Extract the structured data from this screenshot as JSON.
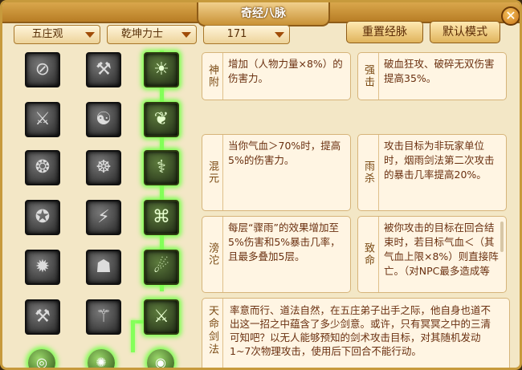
{
  "window": {
    "title": "奇经八脉",
    "close_glyph": "✕"
  },
  "filters": {
    "sect": "五庄观",
    "school": "乾坤力士",
    "level": "171"
  },
  "buttons": {
    "reset": "重置经脉",
    "default": "默认模式"
  },
  "skills": {
    "rows": [
      [
        "⊘",
        "⚒",
        "☀"
      ],
      [
        "⚔",
        "☯",
        "❦"
      ],
      [
        "❂",
        "☸",
        "⚕"
      ],
      [
        "✪",
        "⚡",
        "⌘"
      ],
      [
        "✹",
        "☗",
        "☄"
      ],
      [
        "⚒",
        "⚚",
        "⚔"
      ]
    ],
    "bottom": [
      "◎",
      "✺",
      "◉"
    ]
  },
  "cards": [
    {
      "label": "神附",
      "text": "增加（人物力量×8%）的伤害力。"
    },
    {
      "label": "强击",
      "text": "破血狂攻、破碎无双伤害提高35%。"
    },
    {
      "label": "混元",
      "text": "当你气血＞70%时，提高5%的伤害力。"
    },
    {
      "label": "雨杀",
      "text": "攻击目标为非玩家单位时，烟雨剑法第二次攻击的暴击几率提高20%。"
    },
    {
      "label": "滂沱",
      "text": "每层“骤雨”的效果增加至5%伤害和5%暴击几率，且最多叠加5层。"
    },
    {
      "label": "致命",
      "text": "被你攻击的目标在回合结束时，若目标气血＜（其气血上限×8%）则直接阵亡。（对NPC最多造成等"
    }
  ],
  "bigcard": {
    "label": "天命剑法",
    "text": "率意而行、道法自然，在五庄弟子出手之际，他自身也道不出这一招之中蕴含了多少剑意。或许，只有冥冥之中的三清可知吧？以无人能够预知的剑术攻击目标，对其随机发动1~7次物理攻击，使用后下回合不能行动。"
  }
}
